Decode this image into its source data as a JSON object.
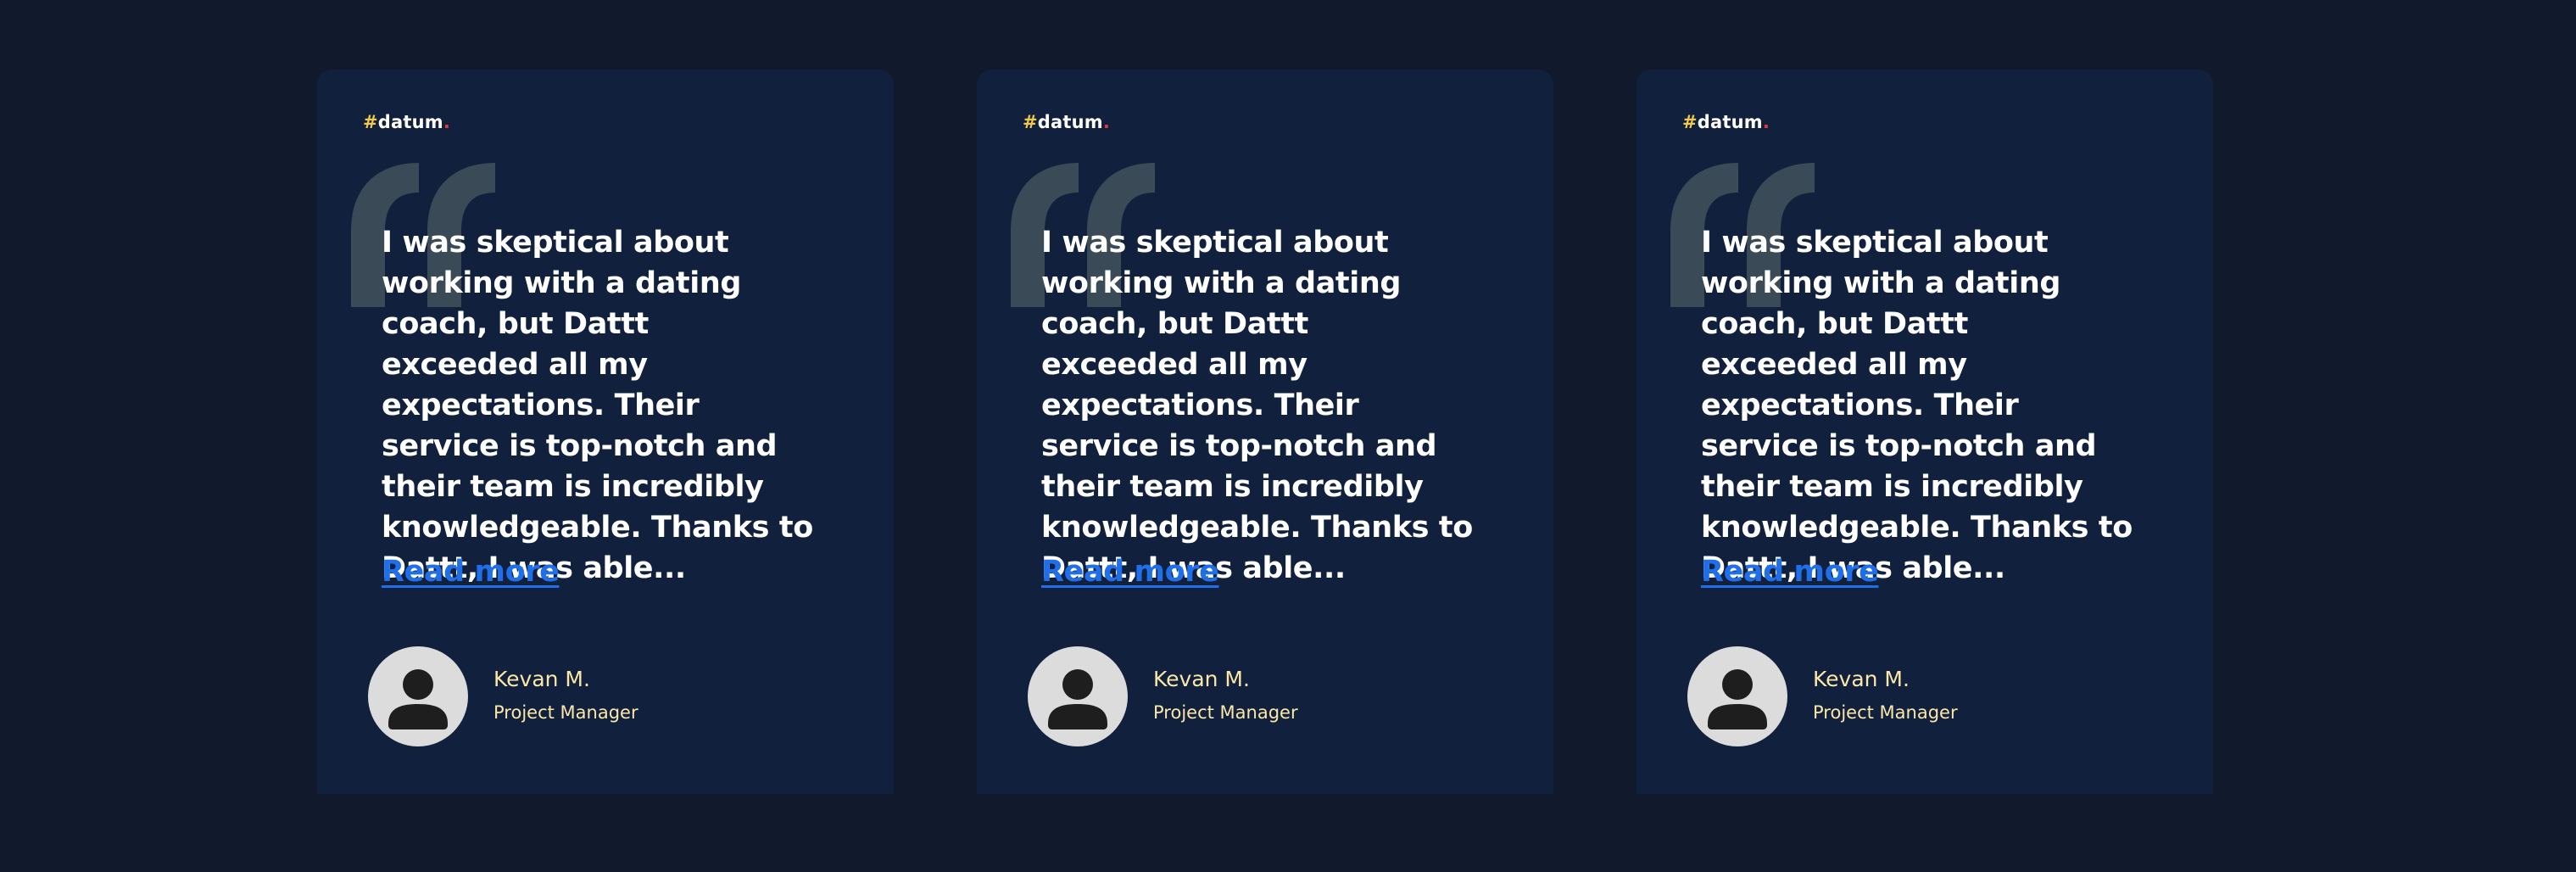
{
  "brand": {
    "hash": "#",
    "name": "datum",
    "dot": "."
  },
  "colors": {
    "page_background": "#111a2c",
    "card_background": "#11203c",
    "quote_mark": "#3a4a56",
    "link": "#1f6feb",
    "author_text": "#fbe7a8",
    "logo_hash": "#f2c94c",
    "logo_dot": "#e53935"
  },
  "testimonials": [
    {
      "quote": "I was skeptical about working with a dating coach, but Dattt exceeded all my expectations. Their service is top-notch and their team is incredibly knowledgeable. Thanks to Dattt, I was able...",
      "read_more": "Read more",
      "author": "Kevan M.",
      "role": "Project Manager",
      "avatar_icon": "user-avatar-icon"
    },
    {
      "quote": "I was skeptical about working with a dating coach, but Dattt exceeded all my expectations. Their service is top-notch and their team is incredibly knowledgeable. Thanks to Dattt, I was able...",
      "read_more": "Read more",
      "author": "Kevan M.",
      "role": "Project Manager",
      "avatar_icon": "user-avatar-icon"
    },
    {
      "quote": "I was skeptical about working with a dating coach, but Dattt exceeded all my expectations. Their service is top-notch and their team is incredibly knowledgeable. Thanks to Dattt, I was able...",
      "read_more": "Read more",
      "author": "Kevan M.",
      "role": "Project Manager",
      "avatar_icon": "user-avatar-icon"
    }
  ]
}
